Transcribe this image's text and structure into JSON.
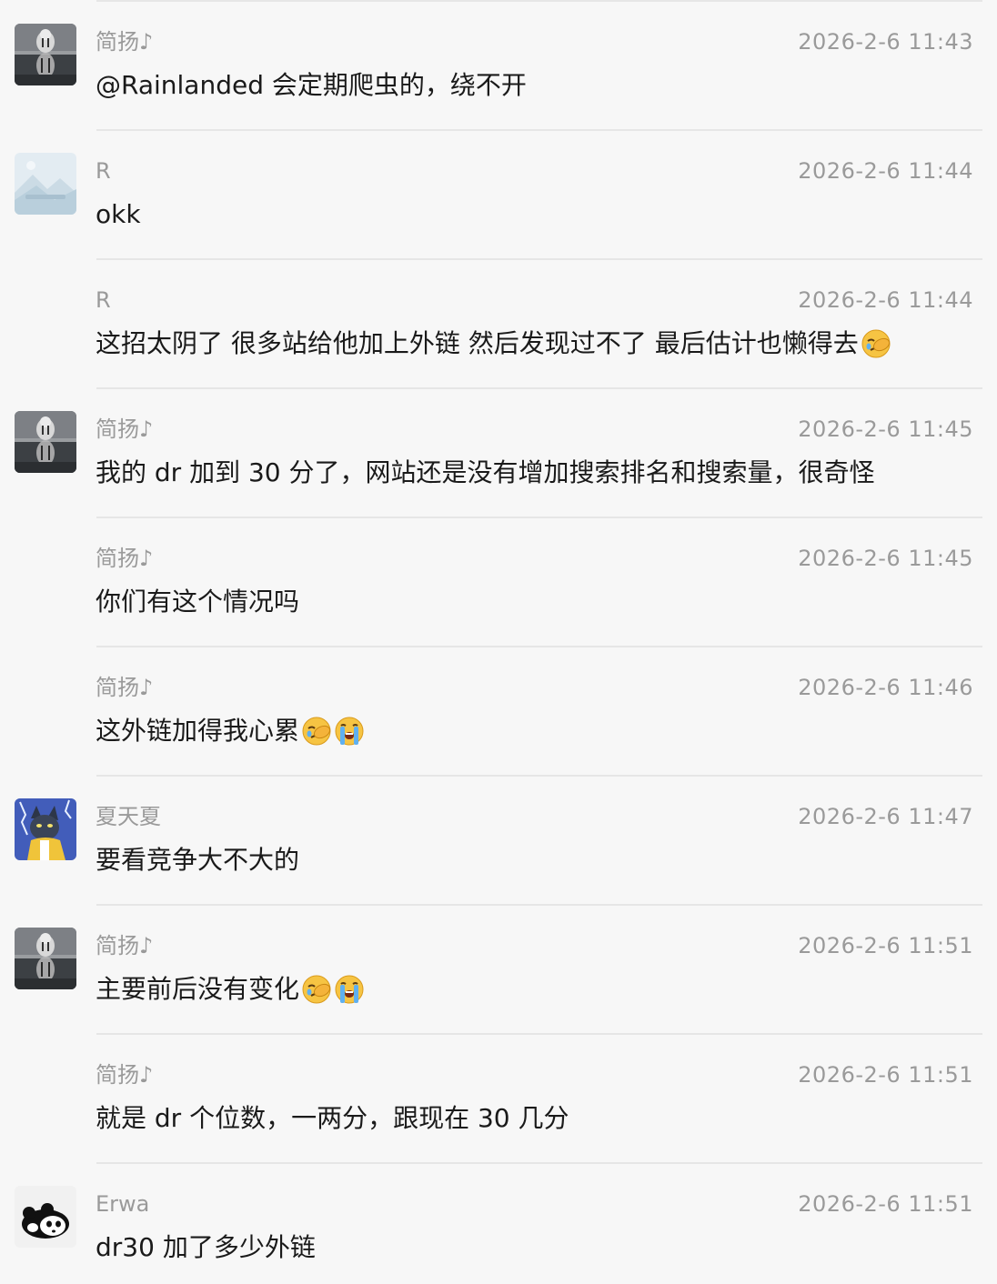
{
  "messages": [
    {
      "avatar": "tiger-reflection-avatar",
      "sender": "简扬♪",
      "time": "2026-2-6 11:43",
      "text": "@Rainlanded 会定期爬虫的，绕不开",
      "emojis": []
    },
    {
      "avatar": "landscape-placeholder-avatar",
      "sender": "R",
      "time": "2026-2-6 11:44",
      "text": "okk",
      "emojis": []
    },
    {
      "avatar": "",
      "sender": "R",
      "time": "2026-2-6 11:44",
      "text": "这招太阴了  很多站给他加上外链  然后发现过不了  最后估计也懒得去",
      "emojis": [
        "facepalm-emoji"
      ]
    },
    {
      "avatar": "tiger-reflection-avatar",
      "sender": "简扬♪",
      "time": "2026-2-6 11:45",
      "text": "我的 dr 加到 30 分了，网站还是没有增加搜索排名和搜索量，很奇怪",
      "emojis": []
    },
    {
      "avatar": "",
      "sender": "简扬♪",
      "time": "2026-2-6 11:45",
      "text": "你们有这个情况吗",
      "emojis": []
    },
    {
      "avatar": "",
      "sender": "简扬♪",
      "time": "2026-2-6 11:46",
      "text": "这外链加得我心累",
      "emojis": [
        "facepalm-emoji",
        "crying-emoji"
      ]
    },
    {
      "avatar": "cartoon-cat-avatar",
      "sender": "夏天夏",
      "time": "2026-2-6 11:47",
      "text": "要看竞争大不大的",
      "emojis": []
    },
    {
      "avatar": "tiger-reflection-avatar",
      "sender": "简扬♪",
      "time": "2026-2-6 11:51",
      "text": "主要前后没有变化",
      "emojis": [
        "facepalm-emoji",
        "crying-emoji"
      ]
    },
    {
      "avatar": "",
      "sender": "简扬♪",
      "time": "2026-2-6 11:51",
      "text": "就是 dr 个位数，一两分，跟现在 30 几分",
      "emojis": []
    },
    {
      "avatar": "panda-avatar",
      "sender": "Erwa",
      "time": "2026-2-6 11:51",
      "text": "dr30 加了多少外链",
      "emojis": []
    }
  ]
}
